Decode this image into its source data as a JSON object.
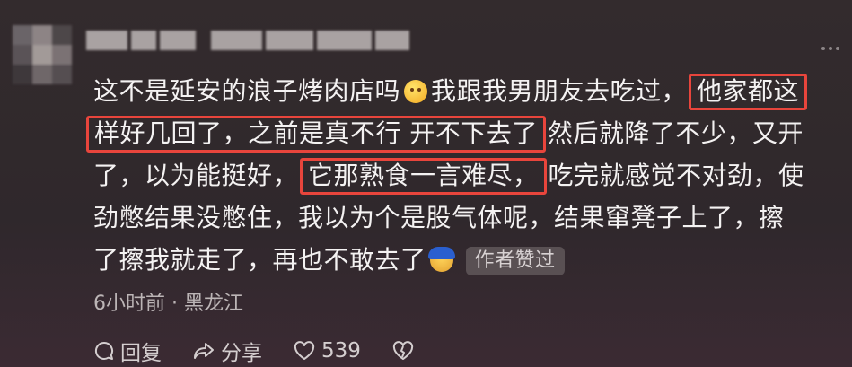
{
  "comment": {
    "lines": [
      {
        "pre": "这不是延安的浪子烤肉店吗",
        "mid": "我跟我男朋友去吃过，",
        "hl": "他家都这"
      },
      {
        "hl": "样好几回了，之前是真不行 开不下去了",
        "post": "然后就降了不少，又开"
      },
      {
        "pre": "了，以为能挺好，",
        "hl": "它那熟食一言难尽，",
        "post": "吃完就感觉不对劲，使"
      },
      {
        "text": "劲憋结果没憋住，我以为个是股气体呢，结果窜凳子上了，擦"
      },
      {
        "text": "了擦我就走了，再也不敢去了",
        "badge": "作者赞过"
      }
    ]
  },
  "meta": {
    "time": "6小时前",
    "sep": "·",
    "location": "黑龙江"
  },
  "actions": {
    "reply": "回复",
    "share": "分享",
    "likes": "539"
  },
  "colors": {
    "highlight": "#e8453c"
  }
}
